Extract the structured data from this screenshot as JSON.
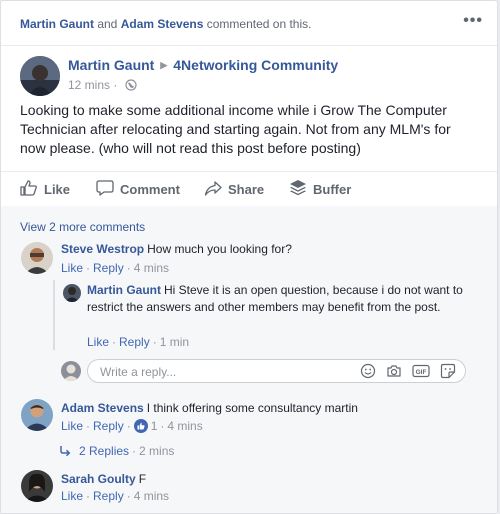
{
  "notice": {
    "name1": "Martin Gaunt",
    "joiner": " and ",
    "name2": "Adam Stevens",
    "suffix": " commented on this.",
    "more": "•••"
  },
  "post": {
    "author": "Martin Gaunt",
    "group": "4Networking Community",
    "time": "12 mins",
    "meta_sep": "·",
    "text": "Looking to make some additional income while i Grow The Computer Technician after relocating and starting again. Not from any MLM's for now please. (who will not read this post before posting)"
  },
  "actions": {
    "like": "Like",
    "comment": "Comment",
    "share": "Share",
    "buffer": "Buffer"
  },
  "comments": {
    "view_more": "View 2 more comments",
    "items": [
      {
        "author": "Steve Westrop",
        "text": "How much you looking for?",
        "like": "Like",
        "reply": "Reply",
        "time": "4 mins"
      },
      {
        "author": "Martin Gaunt",
        "text": "Hi Steve it is an open question, because i do not want to restrict the answers and other members may benefit from the post.",
        "like": "Like",
        "reply": "Reply",
        "time": "1 min"
      },
      {
        "author": "Adam Stevens",
        "text": "I think offering some consultancy martin",
        "like": "Like",
        "reply": "Reply",
        "reaction_count": "1",
        "time": "4 mins"
      },
      {
        "author": "Sarah Goulty",
        "text": "F",
        "like": "Like",
        "reply": "Reply",
        "time": "4 mins"
      }
    ],
    "reply_placeholder": "Write a reply...",
    "replies_link": "2 Replies",
    "replies_time": "2 mins",
    "sep": "·"
  },
  "colors": {
    "link": "#365899",
    "action_link": "#4267b2",
    "meta": "#90949c",
    "background": "#e9ebee"
  },
  "icons": [
    "more-icon",
    "group-arrow-icon",
    "globe-icon",
    "like-icon",
    "comment-icon",
    "share-icon",
    "buffer-icon",
    "emoji-icon",
    "camera-icon",
    "gif-icon",
    "sticker-icon",
    "reply-arrow-icon",
    "like-reaction-icon"
  ]
}
